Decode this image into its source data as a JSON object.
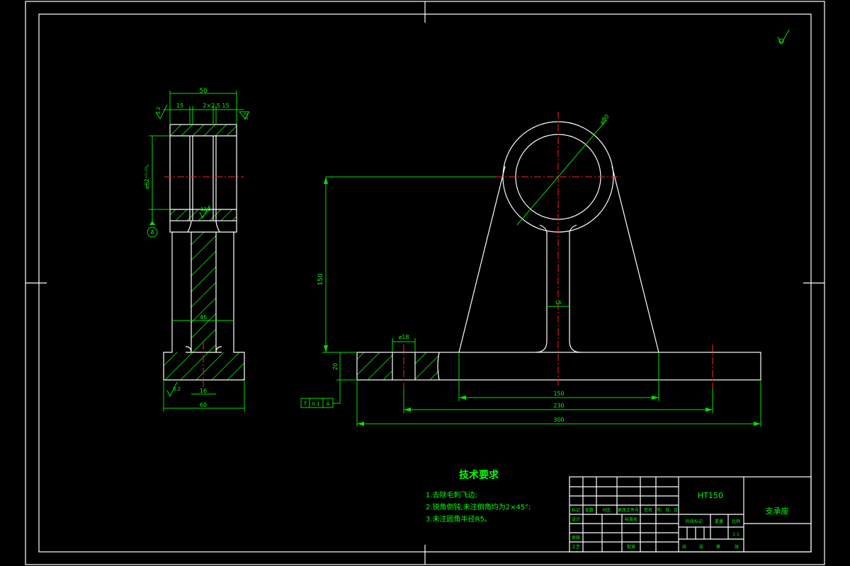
{
  "drawing": {
    "title_material": "HT150",
    "part_name": "支承座",
    "scale": "1:1",
    "tech_req_title": "技术要求",
    "tech_req": [
      "1.去除毛刺飞边;",
      "2.锐角倒钝,未注倒角均为2×45°;",
      "3.未注圆角半径R5。"
    ],
    "dims_left": {
      "width_top": "50",
      "d15": "15",
      "groove": "2×2.5 15",
      "dia": "⌀62⁺⁰·⁰³₀",
      "web": "46",
      "base_hole": "16",
      "base_width": "60",
      "rough1": "3.2",
      "rough2": "3.2",
      "rough3": "12.5",
      "rough4": "3.2",
      "datum": "A"
    },
    "dims_front": {
      "dia80": "⌀80",
      "height": "150",
      "base_h": "20",
      "hole": "⌀18",
      "web": "16",
      "d150": "150",
      "d230": "230",
      "d300": "300"
    },
    "fcf": [
      "f",
      "0.1",
      "A"
    ],
    "title_block": {
      "rev_headers": [
        "标记",
        "处数",
        "分区",
        "更改文件号",
        "签名",
        "年、月、日"
      ],
      "design": "设计",
      "standard": "标准化",
      "check": "审核",
      "process": "工艺",
      "approve": "批准",
      "stage_mark": "阶段标记",
      "weight": "重量",
      "scale_label": "比例",
      "sheets": [
        "共",
        "张",
        "第",
        "张"
      ]
    }
  }
}
